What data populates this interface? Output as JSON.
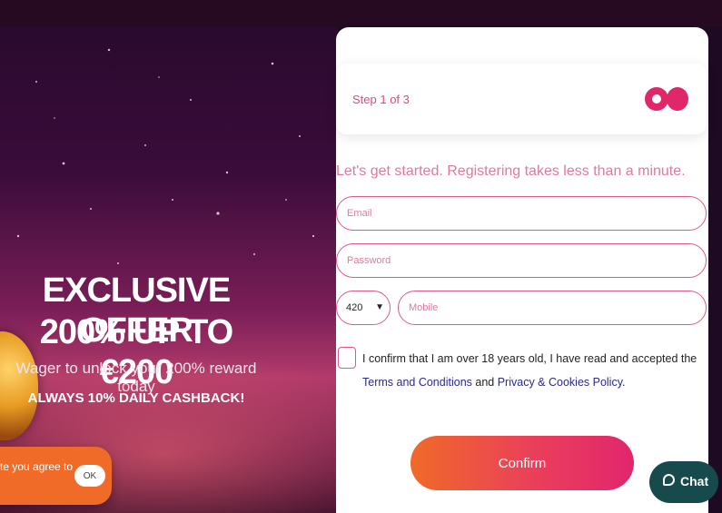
{
  "promo": {
    "title": "EXCLUSIVE OFFER",
    "subtitle": "200% UP TO €200",
    "wager": "Wager to unlock your 200% reward today",
    "cashback": "ALWAYS 10% DAILY CASHBACK!"
  },
  "cookie": {
    "text": "te you agree to",
    "ok_label": "OK"
  },
  "registration": {
    "step_label": "Step 1 of 3",
    "intro": "Let's get started. Registering takes less than a minute.",
    "email_placeholder": "Email",
    "password_placeholder": "Password",
    "country_code": "420",
    "mobile_placeholder": "Mobile",
    "confirm_prefix": "I confirm that I am over 18 years old, I have read and accepted the ",
    "terms_link": "Terms and Conditions",
    "and_text": " and ",
    "privacy_link": "Privacy & Cookies Policy",
    "period": ".",
    "confirm_button": "Confirm"
  },
  "chat": {
    "label": "Chat",
    "icon": "chat-bubble-icon"
  },
  "colors": {
    "accent_pink": "#e0276a",
    "button_start": "#f06a28",
    "button_end": "#e2266e",
    "chat_bg": "#164a4c",
    "cookie_bg": "#f06a28"
  }
}
